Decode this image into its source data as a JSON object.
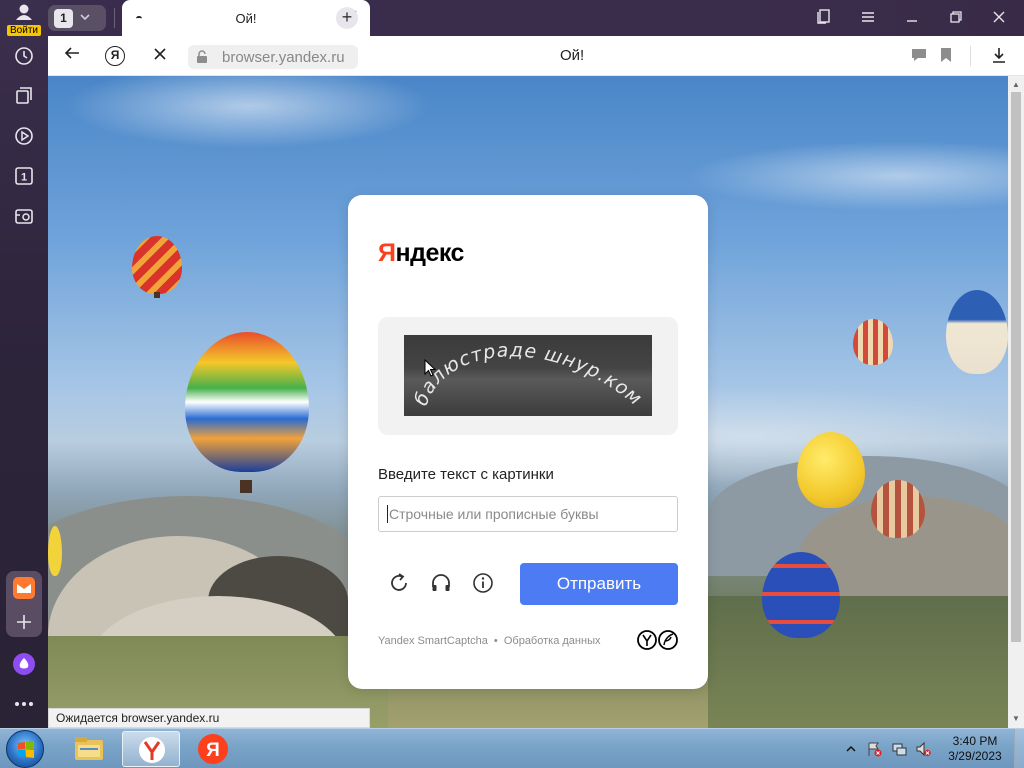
{
  "sidebar": {
    "login_label": "Войти",
    "items": [
      {
        "icon": "history-icon"
      },
      {
        "icon": "collections-icon"
      },
      {
        "icon": "video-icon"
      },
      {
        "icon": "tab-counter-icon",
        "text": "1"
      },
      {
        "icon": "screenshot-icon"
      }
    ],
    "bottom_items": [
      {
        "icon": "mail-icon"
      },
      {
        "icon": "add-icon"
      },
      {
        "icon": "alice-icon"
      },
      {
        "icon": "more-icon"
      }
    ]
  },
  "tabstrip": {
    "tab_count": "1",
    "active_tab_title": "Ой!",
    "new_tab_label": "+"
  },
  "window_controls": {
    "colors": {
      "accent": "#3a2c4d"
    }
  },
  "addressbar": {
    "url": "browser.yandex.ru",
    "page_title": "Ой!"
  },
  "captcha": {
    "logo_first": "Я",
    "logo_rest": "ндекс",
    "captcha_text": "балюстраде шнур.ком",
    "prompt": "Введите текст с картинки",
    "input_placeholder": "Строчные или прописные буквы",
    "input_value": "",
    "submit_label": "Отправить",
    "footer_product": "Yandex SmartCaptcha",
    "footer_sep": "•",
    "footer_link": "Обработка данных",
    "colors": {
      "button": "#4c7bf3",
      "logo_red": "#fc3f1d"
    }
  },
  "statusbar": {
    "text": "Ожидается browser.yandex.ru"
  },
  "taskbar": {
    "time": "3:40 PM",
    "date": "3/29/2023",
    "items": [
      {
        "icon": "explorer-icon"
      },
      {
        "icon": "yandex-browser-icon"
      },
      {
        "icon": "yandex-icon"
      }
    ]
  }
}
